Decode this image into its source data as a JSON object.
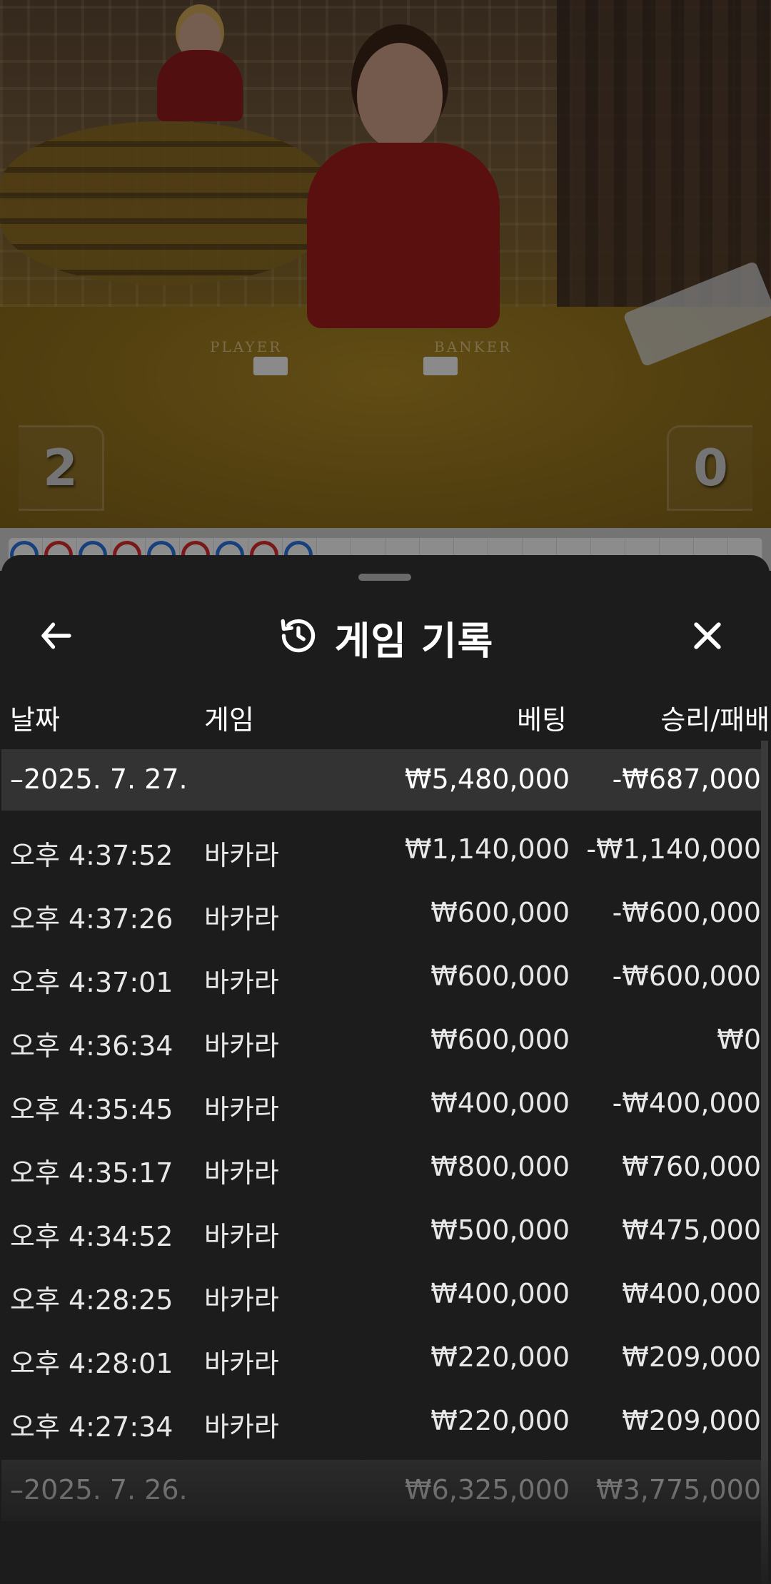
{
  "video": {
    "player_score": "2",
    "banker_score": "0",
    "table_player_label": "PLAYER",
    "table_banker_label": "BANKER"
  },
  "sheet": {
    "title": "게임 기록",
    "icons": {
      "back": "arrow-left-icon",
      "history": "history-clock-icon",
      "close": "close-x-icon"
    },
    "columns": {
      "date": "날짜",
      "game": "게임",
      "bet": "베팅",
      "win_loss": "승리/패배"
    },
    "groups": [
      {
        "date": "–2025. 7. 27.",
        "bet_total": "₩5,480,000",
        "win_total": "-₩687,000",
        "rows": [
          {
            "time": "오후 4:37:52",
            "game": "바카라",
            "bet": "₩1,140,000",
            "result": "-₩1,140,000"
          },
          {
            "time": "오후 4:37:26",
            "game": "바카라",
            "bet": "₩600,000",
            "result": "-₩600,000"
          },
          {
            "time": "오후 4:37:01",
            "game": "바카라",
            "bet": "₩600,000",
            "result": "-₩600,000"
          },
          {
            "time": "오후 4:36:34",
            "game": "바카라",
            "bet": "₩600,000",
            "result": "₩0"
          },
          {
            "time": "오후 4:35:45",
            "game": "바카라",
            "bet": "₩400,000",
            "result": "-₩400,000"
          },
          {
            "time": "오후 4:35:17",
            "game": "바카라",
            "bet": "₩800,000",
            "result": "₩760,000"
          },
          {
            "time": "오후 4:34:52",
            "game": "바카라",
            "bet": "₩500,000",
            "result": "₩475,000"
          },
          {
            "time": "오후 4:28:25",
            "game": "바카라",
            "bet": "₩400,000",
            "result": "₩400,000"
          },
          {
            "time": "오후 4:28:01",
            "game": "바카라",
            "bet": "₩220,000",
            "result": "₩209,000"
          },
          {
            "time": "오후 4:27:34",
            "game": "바카라",
            "bet": "₩220,000",
            "result": "₩209,000"
          }
        ]
      },
      {
        "date": "–2025. 7. 26.",
        "bet_total": "₩6,325,000",
        "win_total": "₩3,775,000",
        "rows": []
      }
    ]
  },
  "colors": {
    "sheet_bg": "#1c1c1c",
    "date_row_bg": "#333333",
    "text": "#ffffff",
    "road_blue": "#2a6fd6",
    "road_red": "#d22a2a"
  }
}
